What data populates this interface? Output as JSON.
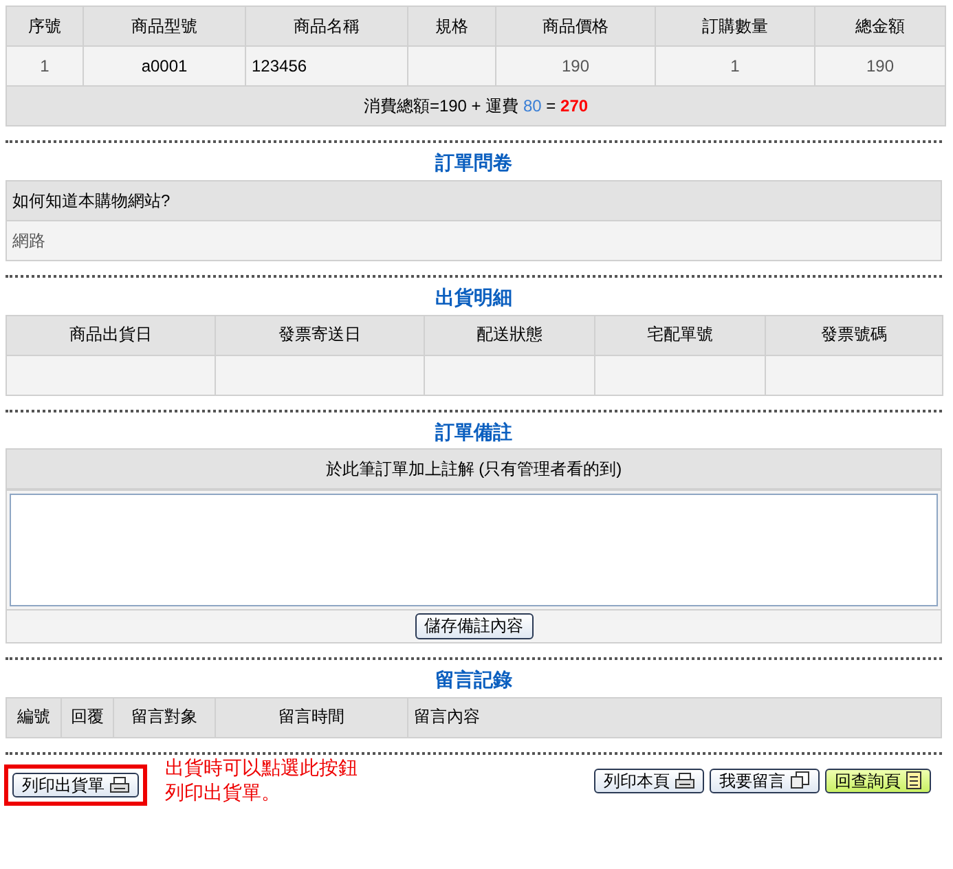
{
  "order_table": {
    "columns": [
      "序號",
      "商品型號",
      "商品名稱",
      "規格",
      "商品價格",
      "訂購數量",
      "總金額"
    ],
    "rows": [
      [
        "1",
        "a0001",
        "123456",
        "",
        "190",
        "1",
        "190"
      ]
    ],
    "summary": {
      "label": "消費總額=190 + 運費",
      "shipping": "80",
      "equals": "=",
      "total": "270"
    }
  },
  "survey": {
    "title": "訂單問卷",
    "question": "如何知道本購物網站?",
    "answer": "網路"
  },
  "shipping": {
    "title": "出貨明細",
    "columns": [
      "商品出貨日",
      "發票寄送日",
      "配送狀態",
      "宅配單號",
      "發票號碼"
    ]
  },
  "note": {
    "title": "訂單備註",
    "header": "於此筆訂單加上註解 (只有管理者看的到)",
    "save_button": "儲存備註內容"
  },
  "messages": {
    "title": "留言記錄",
    "columns": [
      "編號",
      "回覆",
      "留言對象",
      "留言時間",
      "留言內容"
    ]
  },
  "footer": {
    "print_shipping": {
      "label": "列印出貨單",
      "highlighted": true
    },
    "hint": "出貨時可以點選此按鈕列印出貨單。",
    "buttons": [
      {
        "label": "列印本頁",
        "kind": "print"
      },
      {
        "label": "我要留言",
        "kind": "message"
      },
      {
        "label": "回查詢頁",
        "kind": "back"
      }
    ]
  }
}
